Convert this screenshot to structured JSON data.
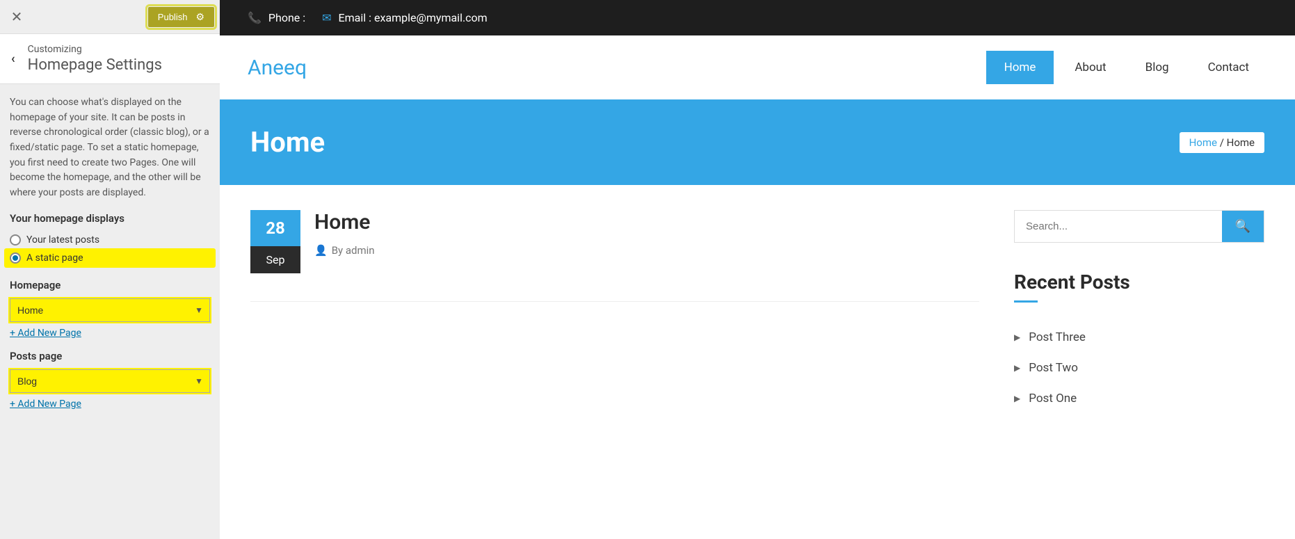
{
  "sidebar": {
    "publish_label": "Publish",
    "customizing_label": "Customizing",
    "section_name": "Homepage Settings",
    "description": "You can choose what's displayed on the homepage of your site. It can be posts in reverse chronological order (classic blog), or a fixed/static page. To set a static homepage, you first need to create two Pages. One will become the homepage, and the other will be where your posts are displayed.",
    "homepage_displays_label": "Your homepage displays",
    "radio_latest": "Your latest posts",
    "radio_static": "A static page",
    "homepage_label": "Homepage",
    "homepage_value": "Home",
    "add_new_page_1": "+ Add New Page",
    "posts_page_label": "Posts page",
    "posts_page_value": "Blog",
    "add_new_page_2": "+ Add New Page"
  },
  "preview": {
    "topbar": {
      "phone_label": "Phone :",
      "email_label": "Email : example@mymail.com"
    },
    "brand": "Aneeq",
    "nav": [
      "Home",
      "About",
      "Blog",
      "Contact"
    ],
    "hero_title": "Home",
    "breadcrumb": {
      "link": "Home",
      "sep": "/",
      "current": "Home"
    },
    "post": {
      "day": "28",
      "month": "Sep",
      "title": "Home",
      "by": "By admin"
    },
    "search_placeholder": "Search...",
    "recent_title": "Recent Posts",
    "recent_posts": [
      "Post Three",
      "Post Two",
      "Post One"
    ]
  }
}
